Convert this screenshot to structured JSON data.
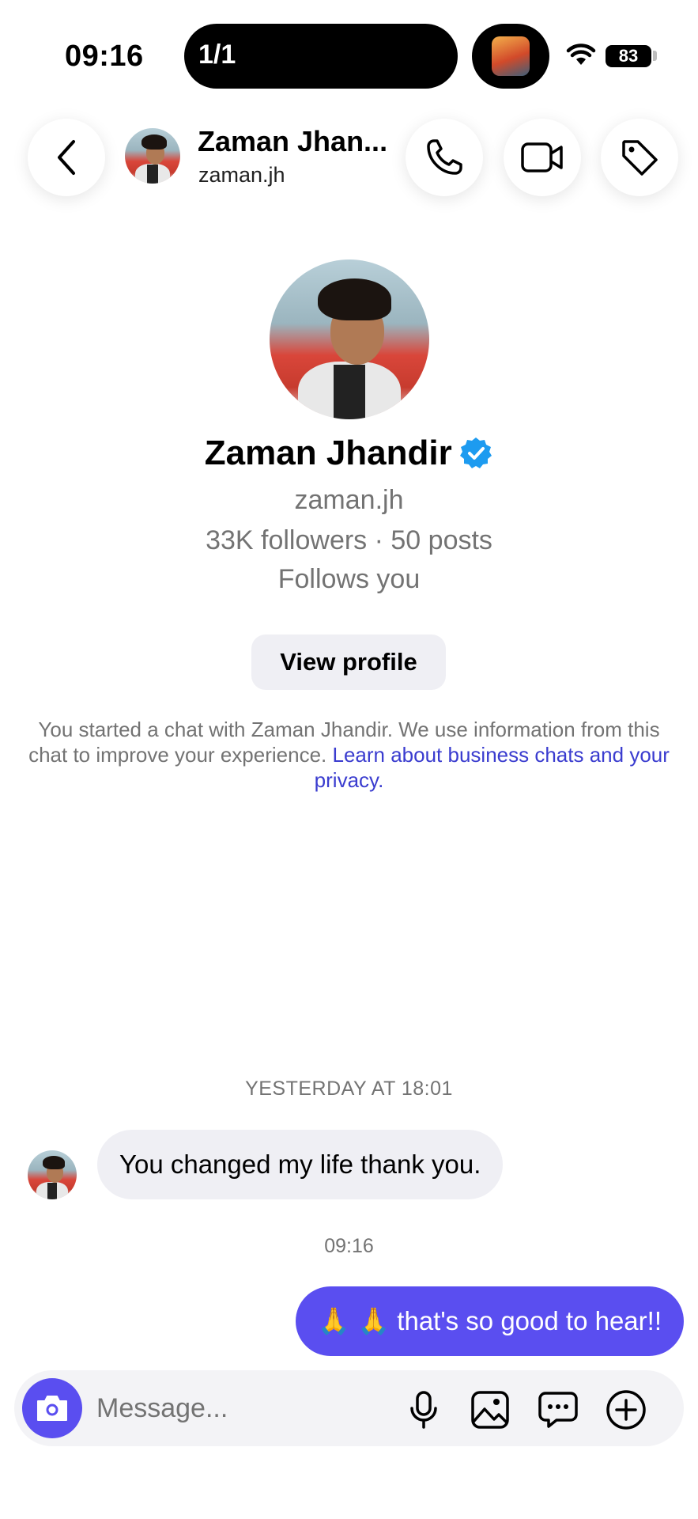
{
  "status_bar": {
    "time": "09:16",
    "island_label": "1/1",
    "battery": "83"
  },
  "header": {
    "name": "Zaman Jhan...",
    "handle": "zaman.jh"
  },
  "profile": {
    "name": "Zaman Jhandir",
    "handle": "zaman.jh",
    "stats": "33K followers · 50 posts",
    "follows_you": "Follows you",
    "view_profile_label": "View profile"
  },
  "notice": {
    "text": "You started a chat with Zaman Jhandir. We use information from this chat to improve your experience. ",
    "link_text": "Learn about business chats and your privacy."
  },
  "messages": [
    {
      "timestamp": "YESTERDAY AT 18:01",
      "text": "You changed my life thank you."
    },
    {
      "timestamp": "09:16",
      "text": "🙏 🙏 that's so good to hear!!"
    }
  ],
  "composer": {
    "placeholder": "Message..."
  },
  "colors": {
    "accent": "#5a4ef0",
    "link": "#3a3ccf",
    "verified": "#1d9bf0",
    "muted_text": "#737373",
    "bubble_in": "#efeff4"
  }
}
